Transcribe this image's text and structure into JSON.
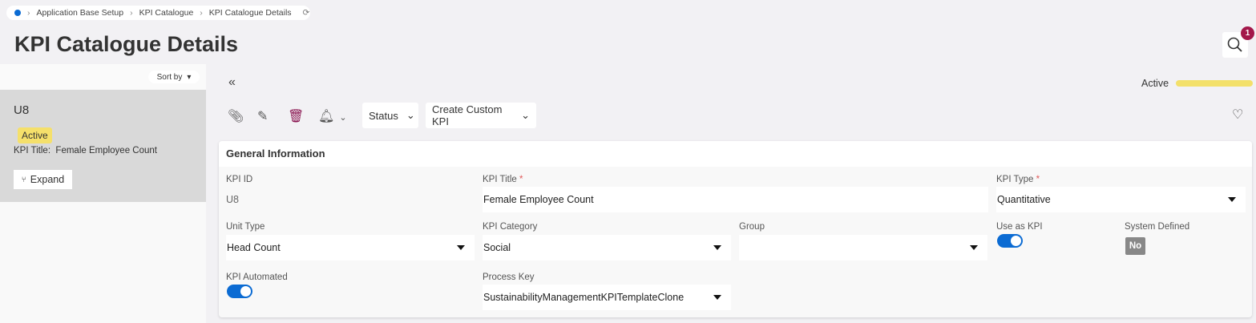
{
  "breadcrumb": [
    "Application Base Setup",
    "KPI Catalogue",
    "KPI Catalogue Details"
  ],
  "page_title": "KPI Catalogue Details",
  "search_badge": "1",
  "list": {
    "sort_by": "Sort by",
    "record": {
      "id": "U8",
      "status": "Active",
      "title_label": "KPI Title:",
      "title": "Female Employee Count",
      "expand": "Expand"
    }
  },
  "status": {
    "label": "Active",
    "color": "#f3e06a"
  },
  "toolbar": {
    "status": "Status",
    "create_custom": "Create Custom KPI"
  },
  "section": {
    "title": "General Information"
  },
  "fields": {
    "kpi_id": {
      "label": "KPI ID",
      "value": "U8"
    },
    "kpi_title": {
      "label": "KPI Title",
      "value": "Female Employee Count"
    },
    "kpi_type": {
      "label": "KPI Type",
      "value": "Quantitative"
    },
    "unit_type": {
      "label": "Unit Type",
      "value": "Head Count"
    },
    "kpi_category": {
      "label": "KPI Category",
      "value": "Social"
    },
    "group": {
      "label": "Group",
      "value": ""
    },
    "use_as_kpi": {
      "label": "Use as KPI",
      "value": true
    },
    "system_defined": {
      "label": "System Defined",
      "value": "No"
    },
    "kpi_automated": {
      "label": "KPI Automated",
      "value": true
    },
    "process_key": {
      "label": "Process Key",
      "value": "SustainabilityManagementKPITemplateClone"
    }
  },
  "required_mark": "*"
}
